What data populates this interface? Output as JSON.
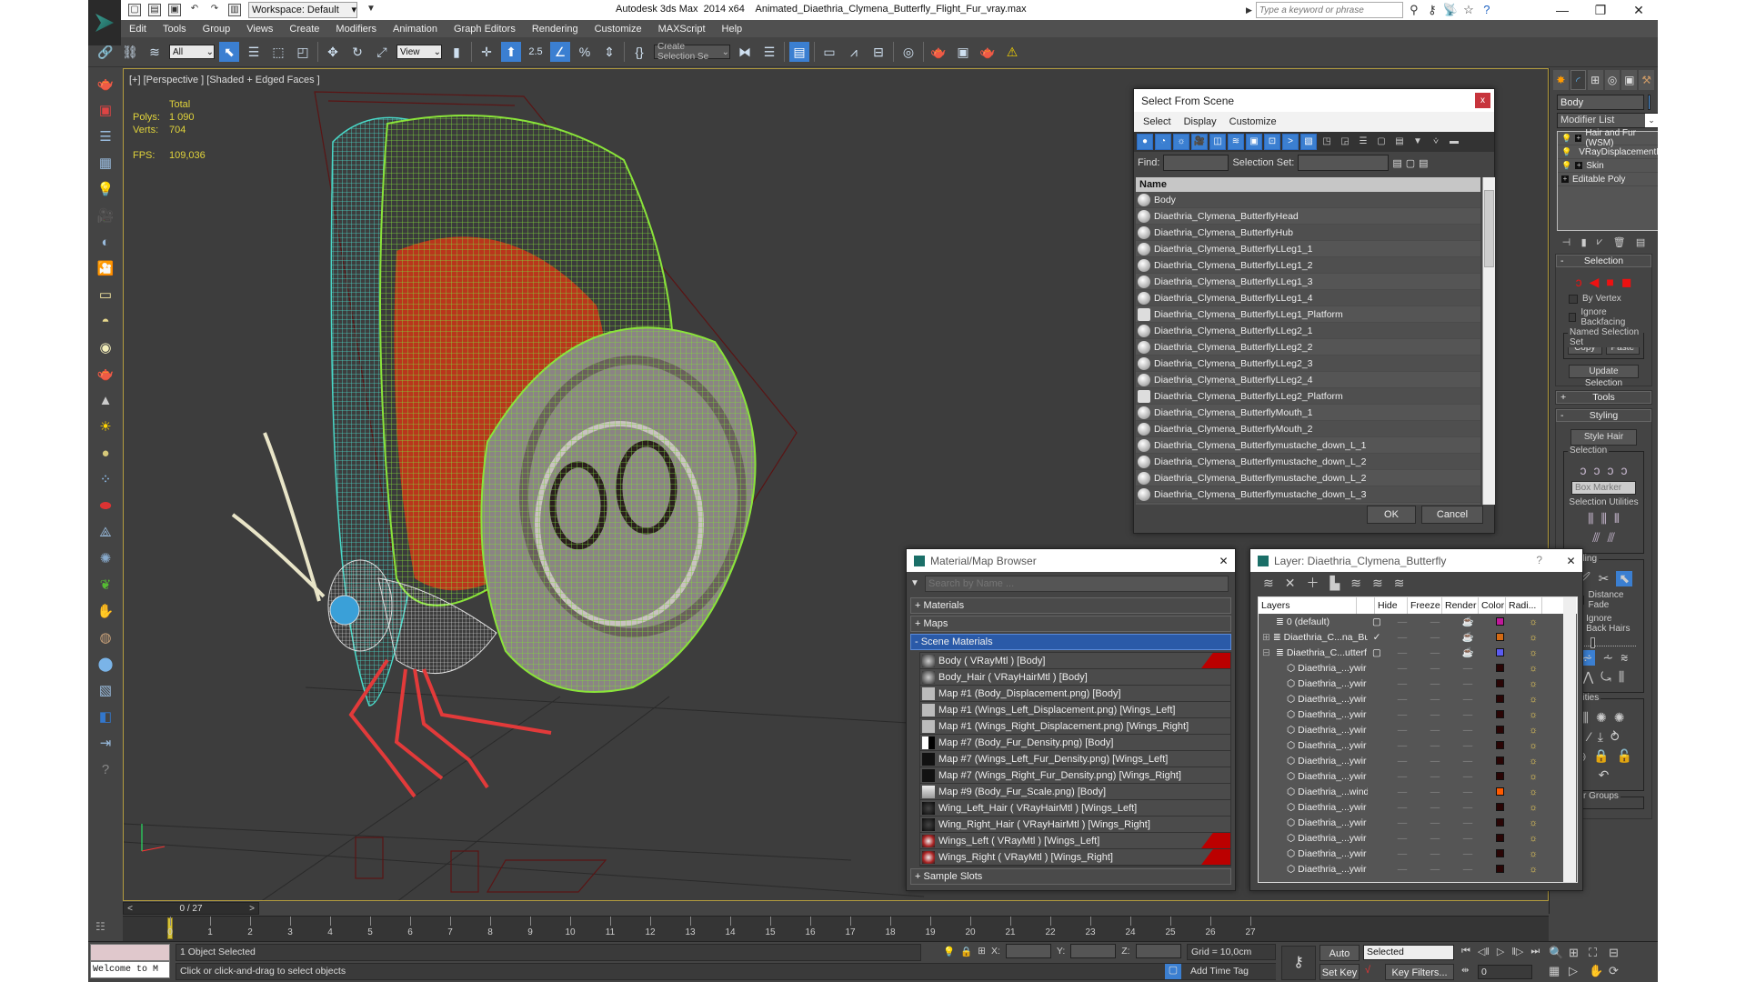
{
  "window": {
    "app_title": "Autodesk 3ds Max  2014 x64",
    "file_title": "Animated_Diaethria_Clymena_Butterfly_Flight_Fur_vray.max",
    "workspace": "Workspace: Default",
    "search_placeholder": "Type a keyword or phrase",
    "controls": {
      "minimize": "—",
      "restore": "❐",
      "close": "✕"
    }
  },
  "menu": [
    "Edit",
    "Tools",
    "Group",
    "Views",
    "Create",
    "Modifiers",
    "Animation",
    "Graph Editors",
    "Rendering",
    "Customize",
    "MAXScript",
    "Help"
  ],
  "toolbar": {
    "selection_filter": "All",
    "ref_coord": "View",
    "snap_angle_label": "2.5",
    "named_selection": "Create Selection Se"
  },
  "viewport": {
    "label": "[+] [Perspective ] [Shaded + Edged Faces ]",
    "stats": {
      "header": "Total",
      "polys_label": "Polys:",
      "polys": "1 090",
      "verts_label": "Verts:",
      "verts": "704",
      "fps_label": "FPS:",
      "fps": "109,036"
    }
  },
  "select_from_scene": {
    "title": "Select From Scene",
    "close": "x",
    "menu": [
      "Select",
      "Display",
      "Customize"
    ],
    "find_label": "Find:",
    "find_value": "",
    "selection_set_label": "Selection Set:",
    "column_header": "Name",
    "items": [
      {
        "name": "Body",
        "type": "geometry"
      },
      {
        "name": "Diaethria_Clymena_ButterflyHead",
        "type": "geometry"
      },
      {
        "name": "Diaethria_Clymena_ButterflyHub",
        "type": "geometry"
      },
      {
        "name": "Diaethria_Clymena_ButterflyLLeg1_1",
        "type": "geometry"
      },
      {
        "name": "Diaethria_Clymena_ButterflyLLeg1_2",
        "type": "geometry"
      },
      {
        "name": "Diaethria_Clymena_ButterflyLLeg1_3",
        "type": "geometry"
      },
      {
        "name": "Diaethria_Clymena_ButterflyLLeg1_4",
        "type": "geometry"
      },
      {
        "name": "Diaethria_Clymena_ButterflyLLeg1_Platform",
        "type": "platform"
      },
      {
        "name": "Diaethria_Clymena_ButterflyLLeg2_1",
        "type": "geometry"
      },
      {
        "name": "Diaethria_Clymena_ButterflyLLeg2_2",
        "type": "geometry"
      },
      {
        "name": "Diaethria_Clymena_ButterflyLLeg2_3",
        "type": "geometry"
      },
      {
        "name": "Diaethria_Clymena_ButterflyLLeg2_4",
        "type": "geometry"
      },
      {
        "name": "Diaethria_Clymena_ButterflyLLeg2_Platform",
        "type": "platform"
      },
      {
        "name": "Diaethria_Clymena_ButterflyMouth_1",
        "type": "geometry"
      },
      {
        "name": "Diaethria_Clymena_ButterflyMouth_2",
        "type": "geometry"
      },
      {
        "name": "Diaethria_Clymena_Butterflymustache_down_L_1",
        "type": "geometry"
      },
      {
        "name": "Diaethria_Clymena_Butterflymustache_down_L_2",
        "type": "geometry"
      },
      {
        "name": "Diaethria_Clymena_Butterflymustache_down_L_2",
        "type": "geometry"
      },
      {
        "name": "Diaethria_Clymena_Butterflymustache_down_L_3",
        "type": "geometry"
      }
    ],
    "ok": "OK",
    "cancel": "Cancel"
  },
  "material_browser": {
    "title": "Material/Map Browser",
    "close": "✕",
    "search_placeholder": "Search by Name ...",
    "groups": {
      "materials": "+ Materials",
      "maps": "+ Maps",
      "scene": "- Scene Materials",
      "sample": "+ Sample Slots"
    },
    "items": [
      {
        "label": "Body  ( VRayMtl ) [Body]",
        "swatch": "mtl",
        "flag": true
      },
      {
        "label": "Body_Hair  ( VRayHairMtl ) [Body]",
        "swatch": "mtl",
        "flag": false
      },
      {
        "label": "Map #1 (Body_Displacement.png) [Body]",
        "swatch": "grey",
        "flag": false
      },
      {
        "label": "Map #1 (Wings_Left_Displacement.png) [Wings_Left]",
        "swatch": "grey",
        "flag": false
      },
      {
        "label": "Map #1 (Wings_Right_Displacement.png) [Wings_Right]",
        "swatch": "grey",
        "flag": false
      },
      {
        "label": "Map #7 (Body_Fur_Density.png) [Body]",
        "swatch": "bw",
        "flag": false
      },
      {
        "label": "Map #7 (Wings_Left_Fur_Density.png) [Wings_Left]",
        "swatch": "dark",
        "flag": false
      },
      {
        "label": "Map #7 (Wings_Right_Fur_Density.png) [Wings_Right]",
        "swatch": "dark",
        "flag": false
      },
      {
        "label": "Map #9 (Body_Fur_Scale.png) [Body]",
        "swatch": "light",
        "flag": false
      },
      {
        "label": "Wing_Left_Hair  ( VRayHairMtl ) [Wings_Left]",
        "swatch": "darkball",
        "flag": false
      },
      {
        "label": "Wing_Right_Hair  ( VRayHairMtl ) [Wings_Right]",
        "swatch": "darkball",
        "flag": false
      },
      {
        "label": "Wings_Left  ( VRayMtl ) [Wings_Left]",
        "swatch": "redball",
        "flag": true
      },
      {
        "label": "Wings_Right  ( VRayMtl ) [Wings_Right]",
        "swatch": "redball",
        "flag": true
      }
    ]
  },
  "layer_dialog": {
    "title": "Layer: Diaethria_Clymena_Butterfly",
    "help": "?",
    "close": "✕",
    "columns": [
      "Layers",
      "",
      "Hide",
      "Freeze",
      "Render",
      "Color",
      "Radi..."
    ],
    "rows": [
      {
        "name": "0 (default)",
        "kind": "layer",
        "expand": "",
        "check": "▢",
        "hide": "—",
        "freeze": "—",
        "render": "☕",
        "color": "#c0199a"
      },
      {
        "name": "Diaethria_C...na_Bu",
        "kind": "layer",
        "expand": "⊞",
        "check": "✓",
        "hide": "—",
        "freeze": "—",
        "render": "☕",
        "color": "#d36a14"
      },
      {
        "name": "Diaethria_C...utterf",
        "kind": "layer",
        "expand": "⊟",
        "check": "▢",
        "hide": "—",
        "freeze": "—",
        "render": "☕",
        "color": "#5b5bf0"
      },
      {
        "name": "Diaethria_...ywir",
        "kind": "object",
        "expand": "",
        "check": "",
        "hide": "—",
        "freeze": "—",
        "render": "—",
        "color": "#2a0505"
      },
      {
        "name": "Diaethria_...ywir",
        "kind": "object",
        "expand": "",
        "check": "",
        "hide": "—",
        "freeze": "—",
        "render": "—",
        "color": "#2a0505"
      },
      {
        "name": "Diaethria_...ywir",
        "kind": "object",
        "expand": "",
        "check": "",
        "hide": "—",
        "freeze": "—",
        "render": "—",
        "color": "#2a0505"
      },
      {
        "name": "Diaethria_...ywir",
        "kind": "object",
        "expand": "",
        "check": "",
        "hide": "—",
        "freeze": "—",
        "render": "—",
        "color": "#2a0505"
      },
      {
        "name": "Diaethria_...ywir",
        "kind": "object",
        "expand": "",
        "check": "",
        "hide": "—",
        "freeze": "—",
        "render": "—",
        "color": "#2a0505"
      },
      {
        "name": "Diaethria_...ywir",
        "kind": "object",
        "expand": "",
        "check": "",
        "hide": "—",
        "freeze": "—",
        "render": "—",
        "color": "#2a0505"
      },
      {
        "name": "Diaethria_...ywir",
        "kind": "object",
        "expand": "",
        "check": "",
        "hide": "—",
        "freeze": "—",
        "render": "—",
        "color": "#2a0505"
      },
      {
        "name": "Diaethria_...ywir",
        "kind": "object",
        "expand": "",
        "check": "",
        "hide": "—",
        "freeze": "—",
        "render": "—",
        "color": "#2a0505"
      },
      {
        "name": "Diaethria_...wind",
        "kind": "object",
        "expand": "",
        "check": "",
        "hide": "—",
        "freeze": "—",
        "render": "—",
        "color": "#ff5a00"
      },
      {
        "name": "Diaethria_...ywir",
        "kind": "object",
        "expand": "",
        "check": "",
        "hide": "—",
        "freeze": "—",
        "render": "—",
        "color": "#2a0505"
      },
      {
        "name": "Diaethria_...ywir",
        "kind": "object",
        "expand": "",
        "check": "",
        "hide": "—",
        "freeze": "—",
        "render": "—",
        "color": "#2a0505"
      },
      {
        "name": "Diaethria_...ywir",
        "kind": "object",
        "expand": "",
        "check": "",
        "hide": "—",
        "freeze": "—",
        "render": "—",
        "color": "#2a0505"
      },
      {
        "name": "Diaethria_...ywir",
        "kind": "object",
        "expand": "",
        "check": "",
        "hide": "—",
        "freeze": "—",
        "render": "—",
        "color": "#2a0505"
      },
      {
        "name": "Diaethria_...ywir",
        "kind": "object",
        "expand": "",
        "check": "",
        "hide": "—",
        "freeze": "—",
        "render": "—",
        "color": "#2a0505"
      }
    ]
  },
  "command_panel": {
    "object_name": "Body",
    "object_color": "#4d95e0",
    "modifier_list": "Modifier List",
    "stack": [
      {
        "label": "Hair and Fur (WSM)",
        "bulb": true,
        "plus": true,
        "indent": false
      },
      {
        "label": "VRayDisplacementMod",
        "bulb": true,
        "plus": false,
        "indent": false
      },
      {
        "label": "Skin",
        "bulb": true,
        "plus": true,
        "indent": false
      },
      {
        "label": "Editable Poly",
        "bulb": false,
        "plus": true,
        "indent": true
      }
    ],
    "selection": {
      "title": "Selection",
      "by_vertex": "By Vertex",
      "ignore_backfacing": "Ignore Backfacing",
      "named_set": "Named Selection Set",
      "copy": "Copy",
      "paste": "Paste",
      "update": "Update Selection"
    },
    "tools_title": "Tools",
    "styling": {
      "title": "Styling",
      "style_hair": "Style Hair",
      "selection_group": "Selection",
      "marker": "Box Marker",
      "selection_utilities": "Selection Utilities",
      "styling_group": "Styling",
      "distance_fade": "Distance Fade",
      "distance_fade_checked": true,
      "ignore_back_hairs": "Ignore Back Hairs",
      "ignore_back_hairs_checked": false,
      "utilities_group": "Utilities",
      "hair_groups": "Hair Groups"
    }
  },
  "timeline": {
    "frame_counter": "0 / 27",
    "current_frame": 0,
    "ticks": [
      "0",
      "1",
      "2",
      "3",
      "4",
      "5",
      "6",
      "7",
      "8",
      "9",
      "10",
      "11",
      "12",
      "13",
      "14",
      "15",
      "16",
      "17",
      "18",
      "19",
      "20",
      "21",
      "22",
      "23",
      "24",
      "25",
      "26",
      "27"
    ]
  },
  "status": {
    "maxscript_line": "Welcome to M",
    "selection_status": "1 Object Selected",
    "prompt": "Click or click-and-drag to select objects",
    "x_label": "X:",
    "y_label": "Y:",
    "z_label": "Z:",
    "grid": "Grid = 10,0cm",
    "add_time_tag": "Add Time Tag",
    "auto_key": "Auto Key",
    "set_key": "Set Key",
    "key_mode": "Selected",
    "key_filters": "Key Filters...",
    "frame_value": "0"
  }
}
